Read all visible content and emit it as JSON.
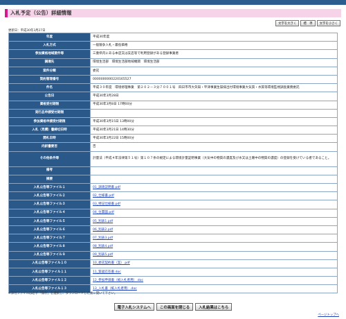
{
  "page_title": "入札予定（公告）詳細情報",
  "text_size": {
    "larger": "文字を大きく",
    "standard": "標　準",
    "smaller": "文字を小さく"
  },
  "updated": "更新日：平成30年3月27日",
  "rows": [
    {
      "label": "年度",
      "value": "平成30年度"
    },
    {
      "label": "入札方式",
      "value": "一般競争入札・最低価格"
    },
    {
      "label": "参加資格地域要件等",
      "value": "三重県内にある本店又は支店等で利用登録がある登録事業者"
    },
    {
      "label": "調達先",
      "value": "環境生活部　環境生活部地域機関　環境生活部"
    },
    {
      "label": "案件分類",
      "value": "委託"
    },
    {
      "label": "契約管理番号",
      "value": "0000000000220165527"
    },
    {
      "label": "件名",
      "value": "平成３０年度　環境修理事業　第２０２－３分７００１号　四日市市大矢知・平津事業生操排出付環境事業大気質・水質等環境監視調査業務委託"
    },
    {
      "label": "公告日",
      "value": "平成30年3月28日"
    },
    {
      "label": "資格受付期限",
      "value": "平成30年3月8日 17時00分"
    },
    {
      "label": "発行品申請受付期限",
      "value": ""
    },
    {
      "label": "参加資格申請受付期限",
      "value": "平成30年3月15日 13時00分"
    },
    {
      "label": "入札（見積）書締切日時",
      "value": "平成30年3月21日 14時30分"
    },
    {
      "label": "開札日時",
      "value": "平成30年3月22日 15時00分"
    },
    {
      "label": "内訳書要否",
      "value": "否"
    },
    {
      "label": "その他条件等",
      "value": "計量法（平成４年法律第５１号）第１０７条の規定による環境計量証明事業（大気中の物質の濃度及び水又は土壌中の物質の濃度）の登録を受けている者であること。",
      "tall": true
    },
    {
      "label": "備考",
      "value": ""
    },
    {
      "label": "摘要",
      "value": ""
    }
  ],
  "files": [
    {
      "label": "入札公告等ファイル１",
      "value": "01_調達説明書.pdf"
    },
    {
      "label": "入札公告等ファイル２",
      "value": "02_仕様書.pdf"
    },
    {
      "label": "入札公告等ファイル３",
      "value": "03_特記仕様書.pdf"
    },
    {
      "label": "入札公告等ファイル４",
      "value": "04_位置図.pdf"
    },
    {
      "label": "入札公告等ファイル５",
      "value": "05_別表1.pdf"
    },
    {
      "label": "入札公告等ファイル６",
      "value": "06_別表2.pdf"
    },
    {
      "label": "入札公告等ファイル７",
      "value": "07_別表3.pdf"
    },
    {
      "label": "入札公告等ファイル８",
      "value": "08_別表4.pdf"
    },
    {
      "label": "入札公告等ファイル９",
      "value": "09_別表5.pdf"
    },
    {
      "label": "入札公告等ファイル１０",
      "value": "10_委託契約書（案）.pdf"
    },
    {
      "label": "入札公告等ファイル１１",
      "value": "11_質疑応答書.doc"
    },
    {
      "label": "入札公告等ファイル１２",
      "value": "12_参加申請書（紙入札者用）.doc"
    },
    {
      "label": "入札公告等ファイル１３",
      "value": "13_入札書（紙入札者用）.doc"
    }
  ],
  "note": "※添付ファイルは必ず「保存」を選択し、ダウンロードした後に開いて下さい。",
  "buttons": {
    "system": "電子入札システムへ",
    "close": "この画面を閉じる",
    "results": "入札結果はこちら"
  },
  "page_top": "ページトップへ"
}
